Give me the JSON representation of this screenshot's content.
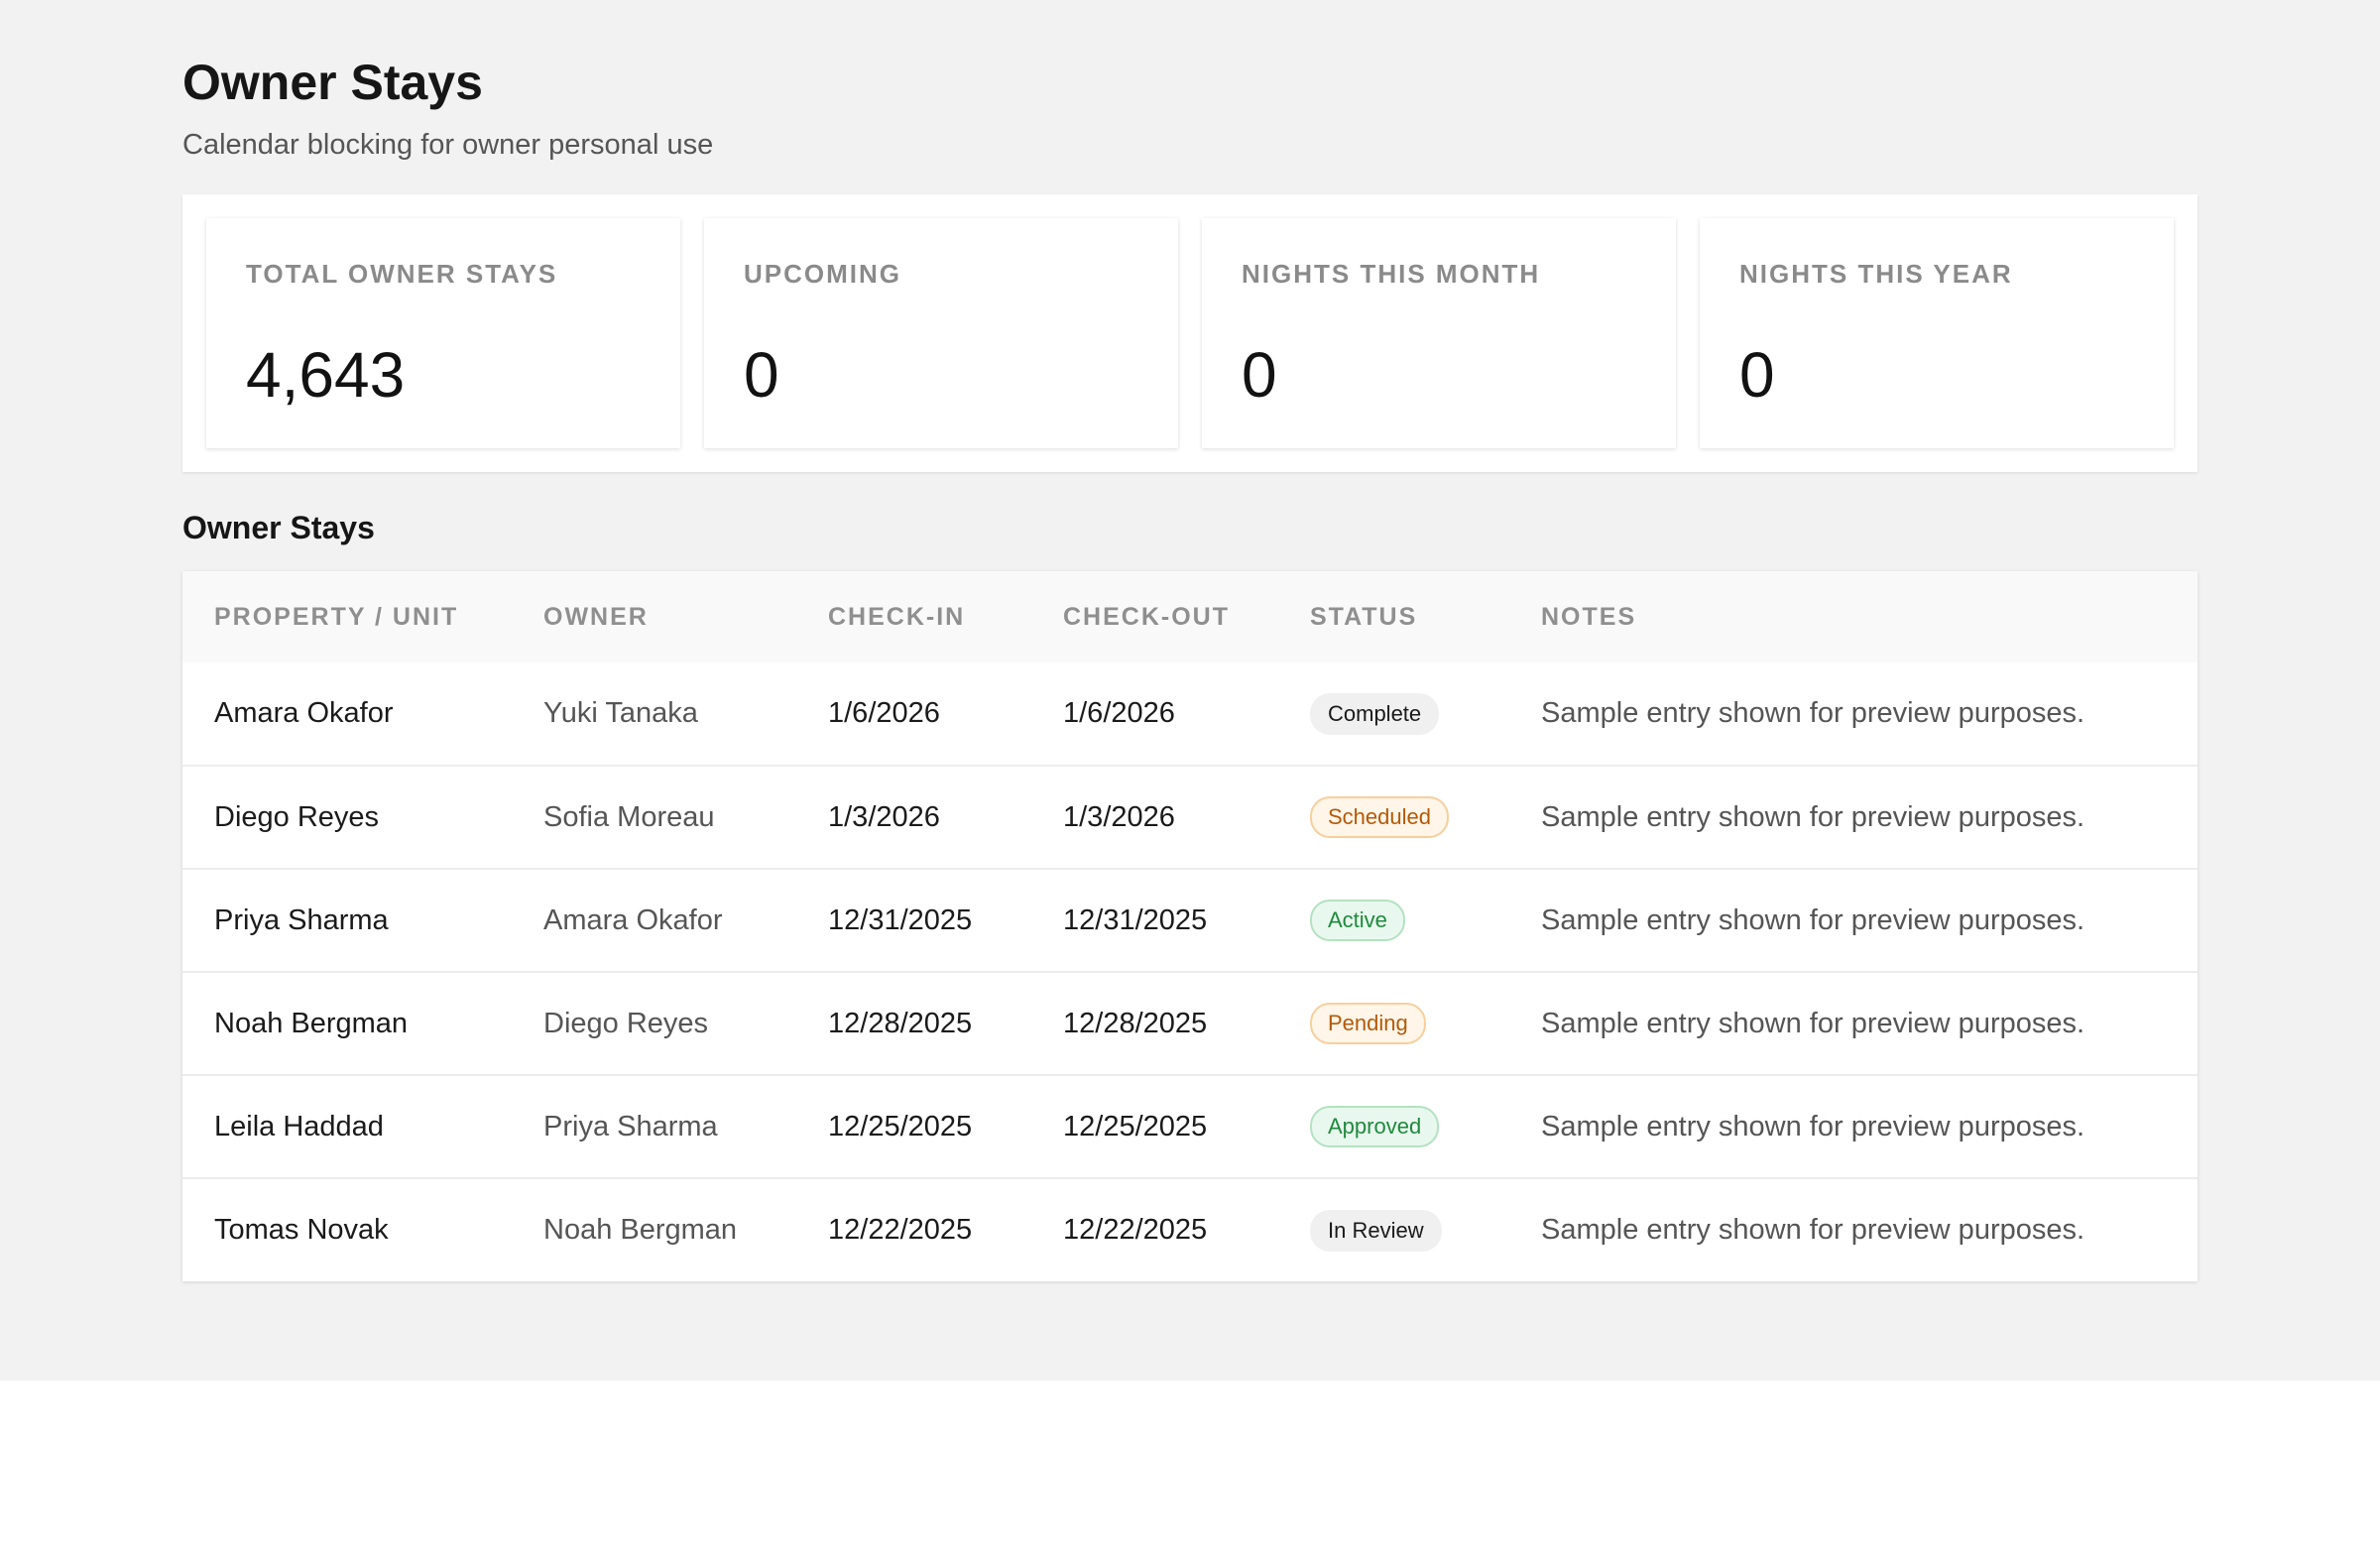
{
  "header": {
    "title": "Owner Stays",
    "subtitle": "Calendar blocking for owner personal use"
  },
  "kpis": [
    {
      "label": "TOTAL OWNER STAYS",
      "value": "4,643"
    },
    {
      "label": "UPCOMING",
      "value": "0"
    },
    {
      "label": "NIGHTS THIS MONTH",
      "value": "0"
    },
    {
      "label": "NIGHTS THIS YEAR",
      "value": "0"
    }
  ],
  "table": {
    "title": "Owner Stays",
    "columns": [
      "PROPERTY / UNIT",
      "OWNER",
      "CHECK-IN",
      "CHECK-OUT",
      "STATUS",
      "NOTES"
    ],
    "rows": [
      {
        "property": "Amara Okafor",
        "owner": "Yuki Tanaka",
        "check_in": "1/6/2026",
        "check_out": "1/6/2026",
        "status": "Complete",
        "status_tone": "neutral",
        "notes": "Sample entry shown for preview purposes."
      },
      {
        "property": "Diego Reyes",
        "owner": "Sofia Moreau",
        "check_in": "1/3/2026",
        "check_out": "1/3/2026",
        "status": "Scheduled",
        "status_tone": "warn",
        "notes": "Sample entry shown for preview purposes."
      },
      {
        "property": "Priya Sharma",
        "owner": "Amara Okafor",
        "check_in": "12/31/2025",
        "check_out": "12/31/2025",
        "status": "Active",
        "status_tone": "success",
        "notes": "Sample entry shown for preview purposes."
      },
      {
        "property": "Noah Bergman",
        "owner": "Diego Reyes",
        "check_in": "12/28/2025",
        "check_out": "12/28/2025",
        "status": "Pending",
        "status_tone": "warn",
        "notes": "Sample entry shown for preview purposes."
      },
      {
        "property": "Leila Haddad",
        "owner": "Priya Sharma",
        "check_in": "12/25/2025",
        "check_out": "12/25/2025",
        "status": "Approved",
        "status_tone": "success",
        "notes": "Sample entry shown for preview purposes."
      },
      {
        "property": "Tomas Novak",
        "owner": "Noah Bergman",
        "check_in": "12/22/2025",
        "check_out": "12/22/2025",
        "status": "In Review",
        "status_tone": "neutral",
        "notes": "Sample entry shown for preview purposes."
      }
    ]
  },
  "colors": {
    "page_background": "#f2f2f2",
    "badge_neutral": "#f0f0f0",
    "badge_warn": "#b45a08",
    "badge_success": "#1f8a3e"
  }
}
